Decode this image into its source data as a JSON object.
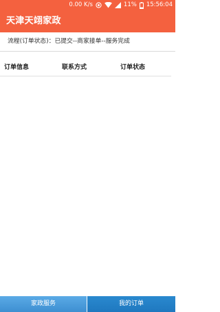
{
  "status_bar": {
    "speed": "0.00 K/s",
    "battery": "11%",
    "time": "15:56:04"
  },
  "header": {
    "title": "天津天翊家政",
    "background_color": "#f4613f"
  },
  "process": {
    "text": "流程(订单状态)：已提交--商家接单--服务完成"
  },
  "table": {
    "columns": [
      "订单信息",
      "联系方式",
      "订单状态"
    ],
    "rows": []
  },
  "tabs": [
    {
      "label": "家政服务"
    },
    {
      "label": "我的订单"
    }
  ]
}
